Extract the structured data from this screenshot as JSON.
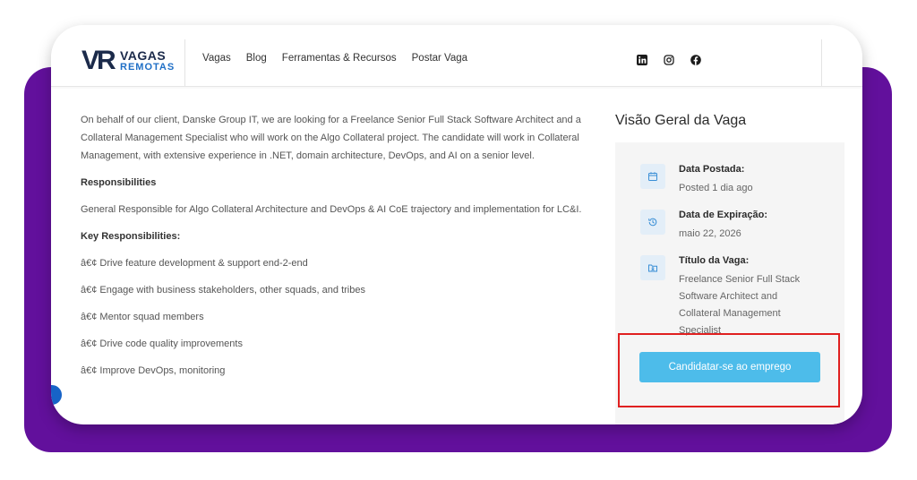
{
  "header": {
    "logo": {
      "mark": "VR",
      "line1": "VAGAS",
      "line2": "REMOTAS"
    },
    "nav": [
      "Vagas",
      "Blog",
      "Ferramentas & Recursos",
      "Postar Vaga"
    ],
    "socials": [
      "linkedin-icon",
      "instagram-icon",
      "facebook-icon"
    ]
  },
  "content": {
    "intro": "On behalf of our client, Danske Group IT, we are looking for a Freelance Senior Full Stack Software Architect and a Collateral Management Specialist who will work on the Algo Collateral project. The candidate will work in Collateral Management, with extensive experience in .NET, domain architecture, DevOps, and AI on a senior level.",
    "responsibilities_title": "Responsibilities",
    "responsibilities_text": "General Responsible for Algo Collateral Architecture and DevOps & AI CoE trajectory and implementation for LC&I.",
    "key_title": "Key Responsibilities:",
    "bullets": [
      "â€¢ Drive feature development & support end-2-end",
      "â€¢ Engage with business stakeholders, other squads, and tribes",
      "â€¢ Mentor squad members",
      "â€¢ Drive code quality improvements",
      "â€¢ Improve DevOps, monitoring"
    ]
  },
  "sidebar": {
    "title": "Visão Geral da Vaga",
    "items": [
      {
        "icon": "calendar-icon",
        "label": "Data Postada:",
        "value": "Posted 1 dia ago"
      },
      {
        "icon": "history-icon",
        "label": "Data de Expiração:",
        "value": "maio 22, 2026"
      },
      {
        "icon": "folder-icon",
        "label": "Título da Vaga:",
        "value": "Freelance Senior Full Stack Software Architect and Collateral Management Specialist"
      }
    ],
    "apply_label": "Candidatar-se ao emprego"
  },
  "colors": {
    "purple": "#62109c",
    "brand_blue": "#1f6fc6",
    "apply_button": "#4dbcea",
    "highlight": "#e02020"
  }
}
